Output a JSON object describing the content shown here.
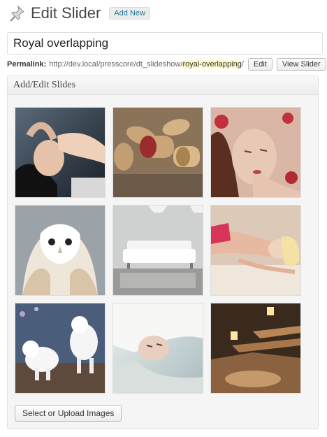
{
  "header": {
    "title": "Edit Slider",
    "add_new_label": "Add New"
  },
  "slider_title": {
    "value": "Royal overlapping"
  },
  "permalink": {
    "label": "Permalink:",
    "url_base": "http://dev.local/presscore/dt_slideshow/",
    "slug": "royal-overlapping",
    "url_end": "/",
    "edit_label": "Edit",
    "view_label": "View Slider"
  },
  "slides_panel": {
    "title": "Add/Edit Slides",
    "upload_label": "Select or Upload Images",
    "slides": [
      {
        "subject": "woman-lying-dark-hair"
      },
      {
        "subject": "wine-corks"
      },
      {
        "subject": "woman-rose-petals"
      },
      {
        "subject": "white-owl"
      },
      {
        "subject": "white-sofa-interior"
      },
      {
        "subject": "blonde-woman-lying"
      },
      {
        "subject": "white-dogs"
      },
      {
        "subject": "woman-white-veil"
      },
      {
        "subject": "lit-stairs"
      }
    ]
  },
  "colors": {
    "link": "#21759b",
    "slug_highlight": "#fffbcc",
    "panel_bg": "#f5f5f5"
  },
  "icons": {
    "header": "pushpin-icon"
  }
}
